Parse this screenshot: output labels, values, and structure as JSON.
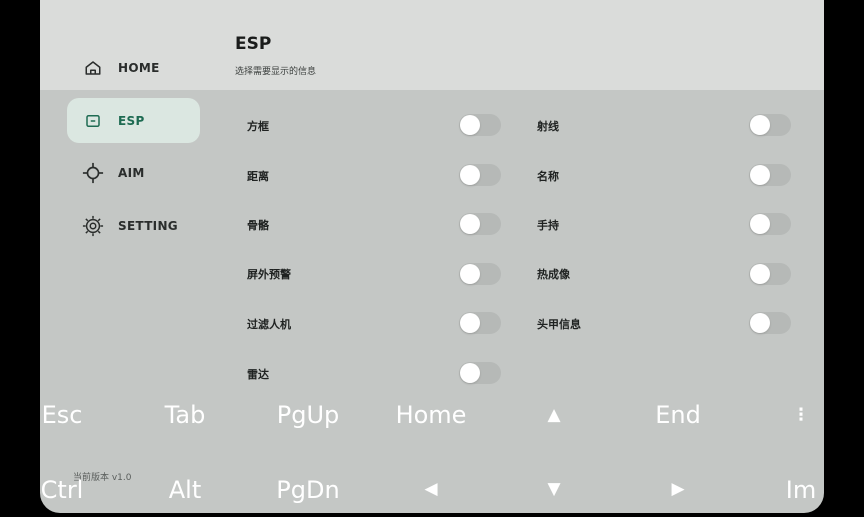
{
  "sidebar": {
    "items": [
      {
        "label": "HOME",
        "icon": "home-icon"
      },
      {
        "label": "ESP",
        "icon": "esp-icon",
        "active": true
      },
      {
        "label": "AIM",
        "icon": "crosshair-icon"
      },
      {
        "label": "SETTING",
        "icon": "gear-icon"
      }
    ],
    "version": "当前版本 v1.0"
  },
  "page": {
    "title": "ESP",
    "subtitle": "选择需要显示的信息"
  },
  "options": {
    "left": [
      {
        "label": "方框",
        "on": false
      },
      {
        "label": "距离",
        "on": false
      },
      {
        "label": "骨骼",
        "on": false
      },
      {
        "label": "屏外预警",
        "on": false
      },
      {
        "label": "过滤人机",
        "on": false
      },
      {
        "label": "雷达",
        "on": false
      }
    ],
    "right": [
      {
        "label": "射线",
        "on": false
      },
      {
        "label": "名称",
        "on": false
      },
      {
        "label": "手持",
        "on": false
      },
      {
        "label": "热成像",
        "on": false
      },
      {
        "label": "头甲信息",
        "on": false
      }
    ]
  },
  "keyboard": {
    "row1": [
      "Esc",
      "Tab",
      "PgUp",
      "Home",
      "▲",
      "End",
      "⋮"
    ],
    "row2": [
      "Ctrl",
      "Alt",
      "PgDn",
      "◀",
      "▼",
      "▶",
      "Im"
    ]
  },
  "colors": {
    "accent": "#1e6b52",
    "active_bg": "#dbe7e1",
    "panel_bg": "#c4c7c5",
    "header_bg": "#dadcda"
  }
}
